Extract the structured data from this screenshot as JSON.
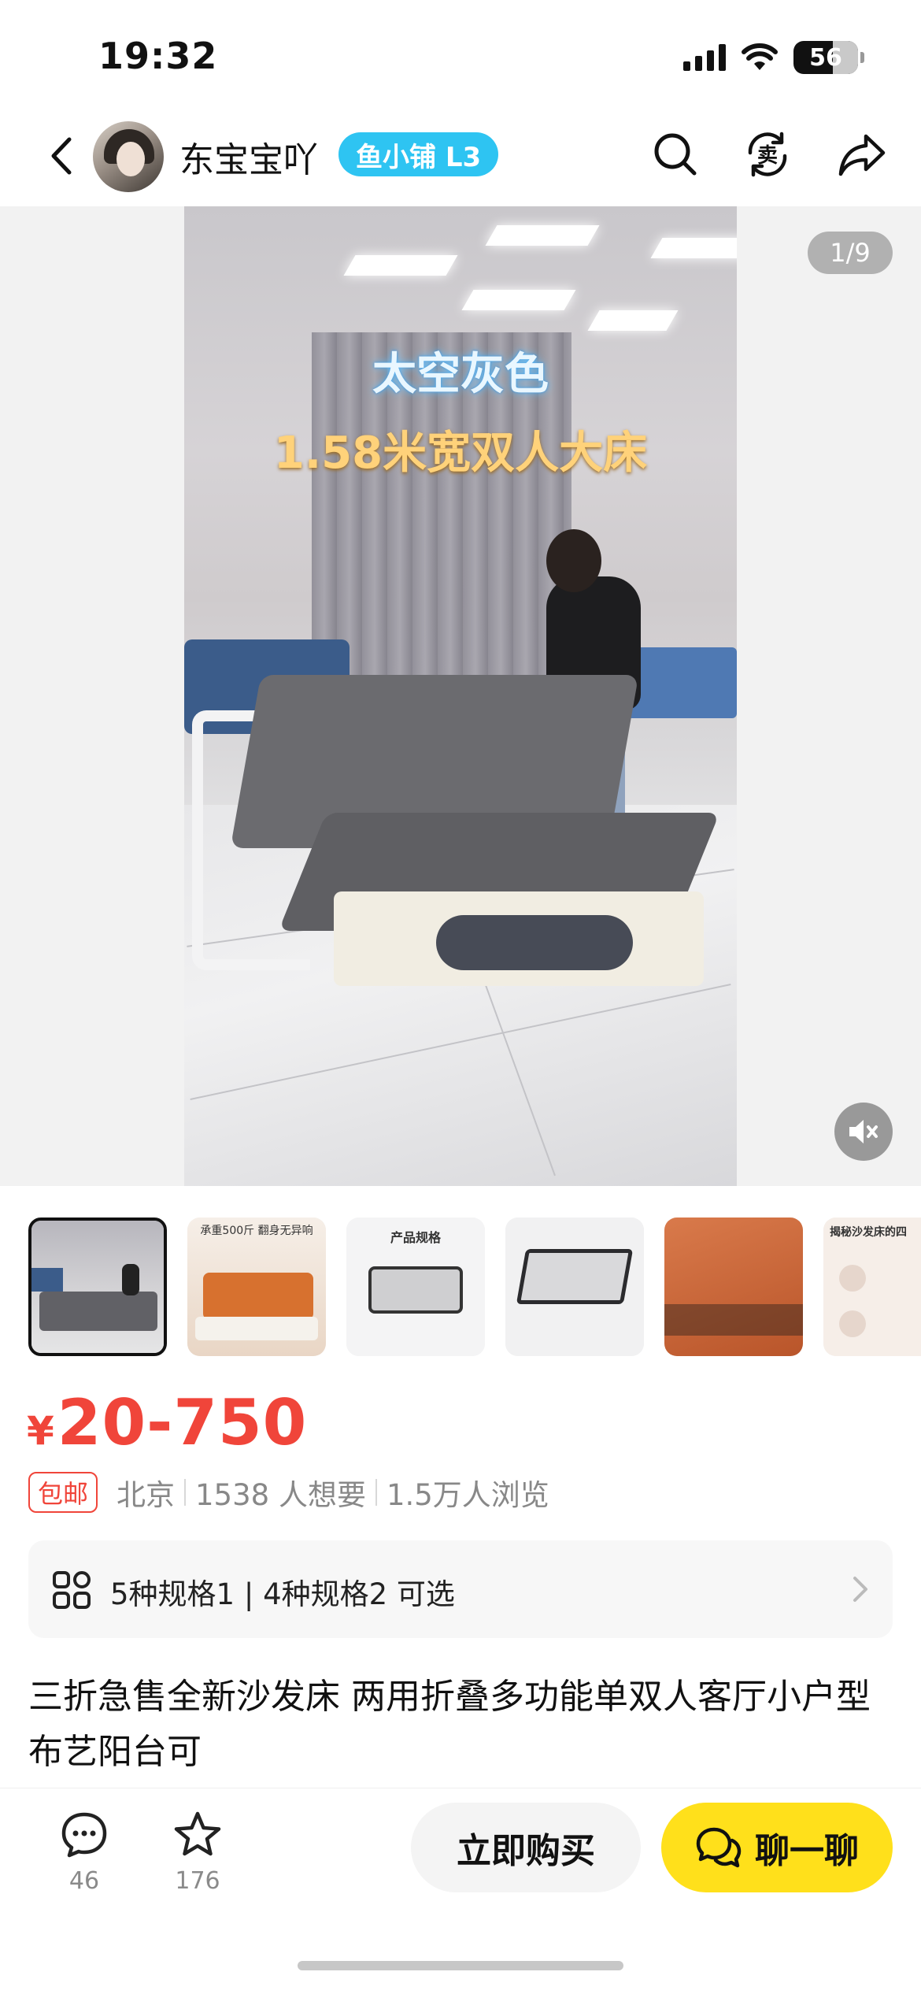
{
  "status_bar": {
    "time": "19:32",
    "battery": "56"
  },
  "nav": {
    "seller_name": "东宝宝吖",
    "level_badge": "鱼小铺 L3",
    "icons": [
      "back-icon",
      "search-icon",
      "sell-icon",
      "share-icon"
    ]
  },
  "gallery": {
    "overlay_color_text": "太空灰色",
    "overlay_size_text": "1.58米宽双人大床",
    "page_indicator": "1/9",
    "thumbnails": [
      {
        "caption": ""
      },
      {
        "caption": "承重500斤 翻身无异响"
      },
      {
        "caption": "产品规格"
      },
      {
        "caption": ""
      },
      {
        "caption": ""
      },
      {
        "caption": "揭秘沙发床的四"
      }
    ]
  },
  "product": {
    "price_symbol": "¥",
    "price": "20-750",
    "free_shipping": "包邮",
    "location": "北京",
    "wants": "1538 人想要",
    "views": "1.5万人浏览",
    "spec_text": "5种规格1 | 4种规格2 可选",
    "title": "三折急售全新沙发床 两用折叠多功能单双人客厅小户型布艺阳台可"
  },
  "bottom_bar": {
    "comment_count": "46",
    "favorite_count": "176",
    "buy_label": "立即购买",
    "chat_label": "聊一聊"
  },
  "colors": {
    "price": "#f0453a",
    "chat_button": "#ffe01b",
    "level_badge": "#2ec4f2"
  }
}
